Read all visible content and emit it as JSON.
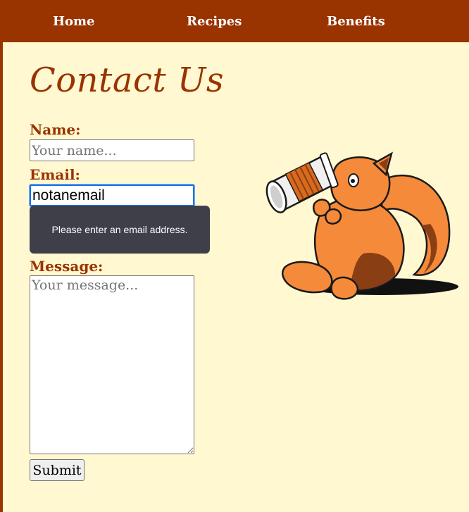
{
  "nav": {
    "items": [
      {
        "label": "Home"
      },
      {
        "label": "Recipes"
      },
      {
        "label": "Benefits"
      }
    ]
  },
  "main": {
    "title": "Contact Us",
    "form": {
      "name_label": "Name:",
      "name_placeholder": "Your name...",
      "email_label": "Email:",
      "email_value": "notanemail",
      "validation_message": "Please enter an email address.",
      "message_label": "Message:",
      "message_placeholder": "Your message...",
      "submit_label": "Submit"
    },
    "illustration": "squirrel-drinking-coffee"
  },
  "colors": {
    "brand": "#993300",
    "background": "#fff8d0",
    "squirrel_orange": "#f58a3a",
    "squirrel_dark": "#8a3e14",
    "tooltip_bg": "#3f3f4a",
    "focus_ring": "#1a73e8"
  }
}
